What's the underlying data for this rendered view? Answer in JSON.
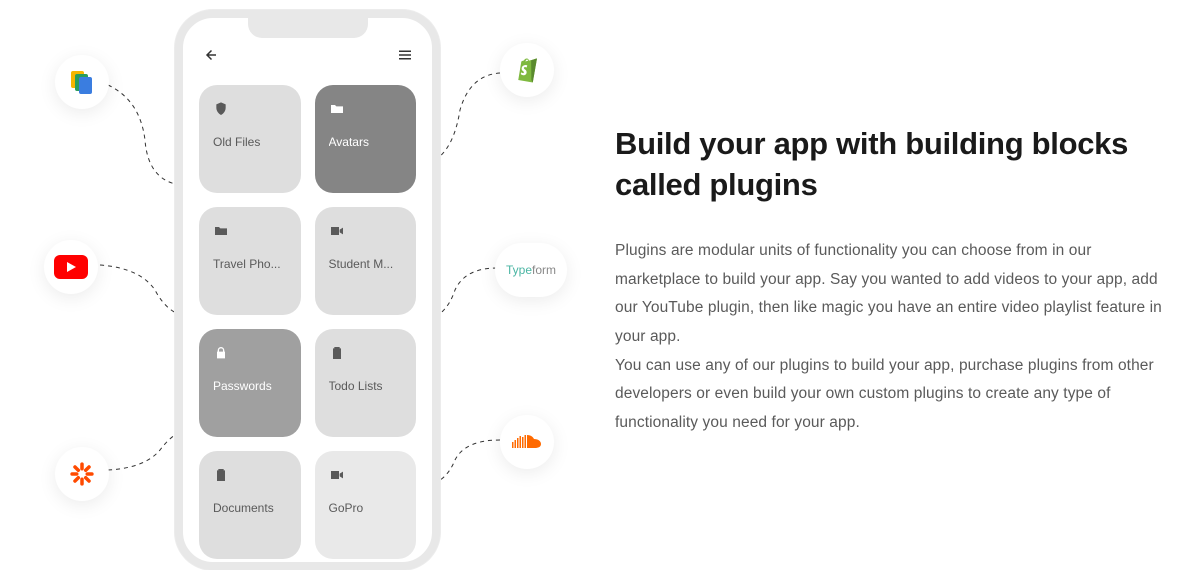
{
  "content": {
    "heading": "Build your app with building blocks called plugins",
    "paragraph": "Plugins are modular units of functionality you can choose from in our marketplace to build your app. Say you wanted to add videos to your app, add our YouTube plugin, then like magic you have an entire video playlist feature in your app.\nYou can use any of our plugins to build your app, purchase plugins from other developers or even build your own custom plugins to create any type of functionality you need for your app."
  },
  "phone": {
    "topbar": {
      "back": "back-arrow",
      "menu": "hamburger-icon"
    },
    "tiles": [
      {
        "label": "Old Files",
        "icon": "shield-icon",
        "variant": "light"
      },
      {
        "label": "Avatars",
        "icon": "folder-icon",
        "variant": "dark"
      },
      {
        "label": "Travel Pho...",
        "icon": "folder-icon",
        "variant": "light"
      },
      {
        "label": "Student M...",
        "icon": "video-icon",
        "variant": "light"
      },
      {
        "label": "Passwords",
        "icon": "lock-icon",
        "variant": "mid"
      },
      {
        "label": "Todo Lists",
        "icon": "clipboard-icon",
        "variant": "light"
      },
      {
        "label": "Documents",
        "icon": "clipboard-icon",
        "variant": "light"
      },
      {
        "label": "GoPro",
        "icon": "video-icon",
        "variant": "faint"
      }
    ]
  },
  "floating_services": {
    "docs": "google-docs-icon",
    "shopify": "shopify-icon",
    "youtube": "youtube-icon",
    "typeform_1": "Type",
    "typeform_2": "form",
    "zapier": "zapier-icon",
    "soundcloud": "soundcloud-icon"
  }
}
